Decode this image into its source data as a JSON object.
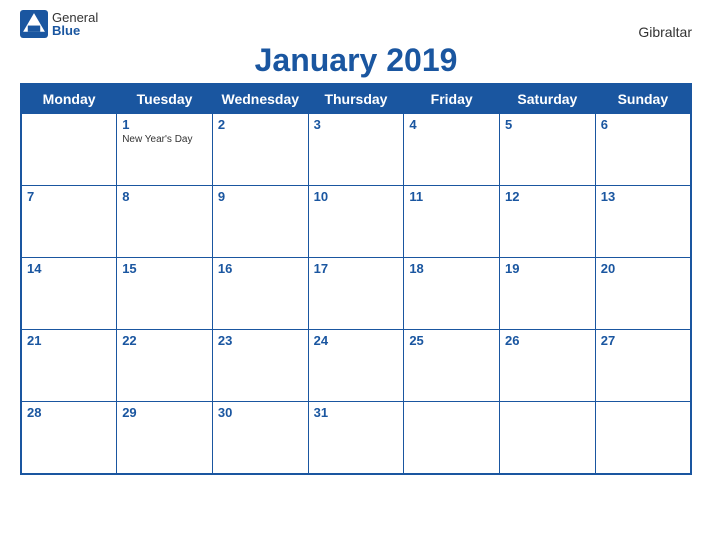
{
  "logo": {
    "general": "General",
    "blue": "Blue",
    "icon_color": "#1a56a0"
  },
  "calendar": {
    "title": "January 2019",
    "region": "Gibraltar",
    "days_of_week": [
      "Monday",
      "Tuesday",
      "Wednesday",
      "Thursday",
      "Friday",
      "Saturday",
      "Sunday"
    ],
    "weeks": [
      [
        {
          "num": "",
          "event": ""
        },
        {
          "num": "1",
          "event": "New Year's Day"
        },
        {
          "num": "2",
          "event": ""
        },
        {
          "num": "3",
          "event": ""
        },
        {
          "num": "4",
          "event": ""
        },
        {
          "num": "5",
          "event": ""
        },
        {
          "num": "6",
          "event": ""
        }
      ],
      [
        {
          "num": "7",
          "event": ""
        },
        {
          "num": "8",
          "event": ""
        },
        {
          "num": "9",
          "event": ""
        },
        {
          "num": "10",
          "event": ""
        },
        {
          "num": "11",
          "event": ""
        },
        {
          "num": "12",
          "event": ""
        },
        {
          "num": "13",
          "event": ""
        }
      ],
      [
        {
          "num": "14",
          "event": ""
        },
        {
          "num": "15",
          "event": ""
        },
        {
          "num": "16",
          "event": ""
        },
        {
          "num": "17",
          "event": ""
        },
        {
          "num": "18",
          "event": ""
        },
        {
          "num": "19",
          "event": ""
        },
        {
          "num": "20",
          "event": ""
        }
      ],
      [
        {
          "num": "21",
          "event": ""
        },
        {
          "num": "22",
          "event": ""
        },
        {
          "num": "23",
          "event": ""
        },
        {
          "num": "24",
          "event": ""
        },
        {
          "num": "25",
          "event": ""
        },
        {
          "num": "26",
          "event": ""
        },
        {
          "num": "27",
          "event": ""
        }
      ],
      [
        {
          "num": "28",
          "event": ""
        },
        {
          "num": "29",
          "event": ""
        },
        {
          "num": "30",
          "event": ""
        },
        {
          "num": "31",
          "event": ""
        },
        {
          "num": "",
          "event": ""
        },
        {
          "num": "",
          "event": ""
        },
        {
          "num": "",
          "event": ""
        }
      ]
    ]
  }
}
